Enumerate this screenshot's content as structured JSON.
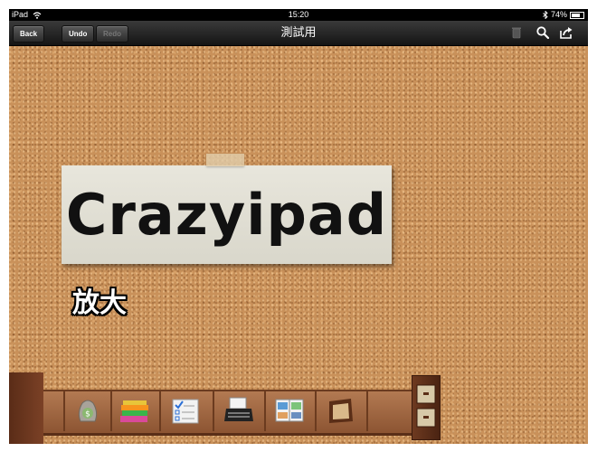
{
  "status": {
    "carrier": "iPad",
    "time": "15:20",
    "battery": "74%",
    "battery_level": 0.74
  },
  "toolbar": {
    "back_label": "Back",
    "undo_label": "Undo",
    "redo_label": "Redo",
    "title": "測試用"
  },
  "board": {
    "note_text": "Crazyipad",
    "caption": "放大"
  },
  "icons": {
    "wifi": "wifi-icon",
    "bluetooth": "bluetooth-icon",
    "battery": "battery-icon",
    "trash": "trash-icon",
    "search": "search-icon",
    "share": "share-icon"
  },
  "shelf": {
    "items": [
      "money-bag-icon",
      "books-icon",
      "checklist-icon",
      "typewriter-icon",
      "photo-album-icon",
      "picture-frame-icon",
      "file-cabinet-icon"
    ]
  },
  "colors": {
    "cork": "#c9915a",
    "toolbar": "#2a2a2a",
    "note": "#e3e1d6"
  }
}
